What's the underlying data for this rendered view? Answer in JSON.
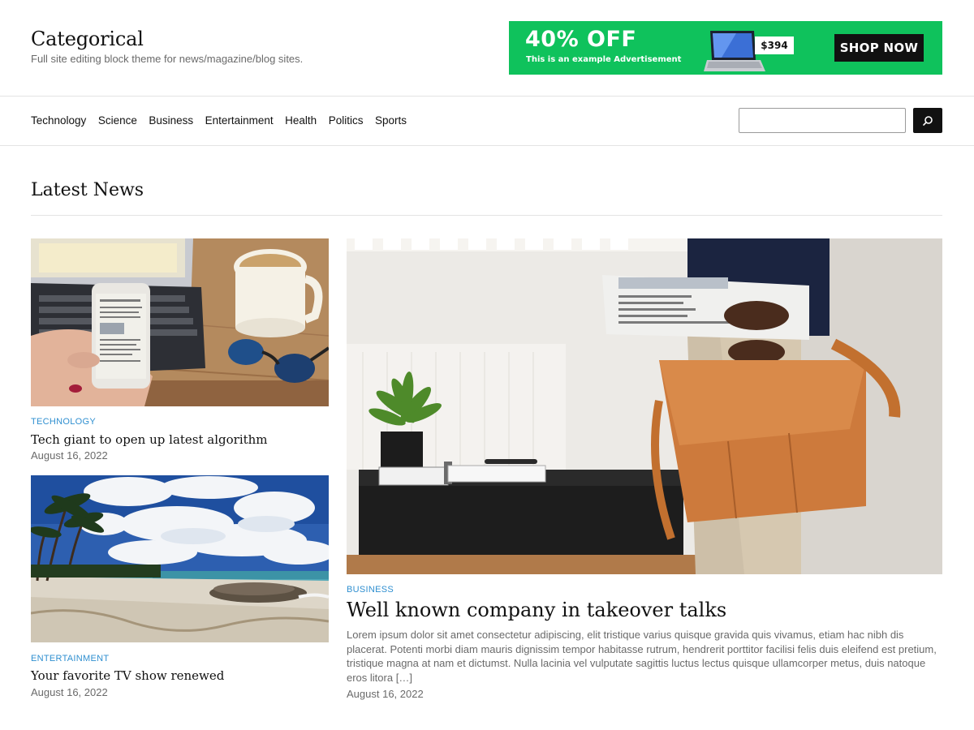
{
  "site": {
    "title": "Categorical",
    "tagline": "Full site editing block theme for news/magazine/blog sites."
  },
  "ad": {
    "headline": "40% OFF",
    "subtext": "This is an example Advertisement",
    "price": "$394",
    "cta": "SHOP NOW",
    "background_color": "#0fc25c"
  },
  "nav": {
    "items": [
      {
        "label": "Technology"
      },
      {
        "label": "Science"
      },
      {
        "label": "Business"
      },
      {
        "label": "Entertainment"
      },
      {
        "label": "Health"
      },
      {
        "label": "Politics"
      },
      {
        "label": "Sports"
      }
    ]
  },
  "search": {
    "placeholder": "",
    "value": "",
    "button_icon": "search-icon"
  },
  "latest": {
    "title": "Latest News"
  },
  "posts": [
    {
      "image_desc": "hand-holding-phone-with-news-laptop-coffee",
      "category": "TECHNOLOGY",
      "title": "Tech giant to open up latest algorithm",
      "date": "August 16, 2022"
    },
    {
      "image_desc": "tropical-beach-with-palm-trees",
      "category": "ENTERTAINMENT",
      "title": "Your favorite TV show renewed",
      "date": "August 16, 2022"
    },
    {
      "image_desc": "businessman-with-newspaper-and-leather-bag",
      "category": "BUSINESS",
      "title": "Well known company in takeover talks",
      "excerpt": "Lorem ipsum dolor sit amet consectetur adipiscing, elit tristique varius quisque gravida quis vivamus, etiam hac nibh dis placerat. Potenti morbi diam mauris dignissim tempor habitasse rutrum, hendrerit porttitor facilisi felis duis eleifend est pretium, tristique magna at nam et dictumst. Nulla lacinia vel vulputate sagittis luctus lectus quisque ullamcorper metus, duis natoque eros litora",
      "read_more": "[…]",
      "date": "August 16, 2022"
    }
  ]
}
